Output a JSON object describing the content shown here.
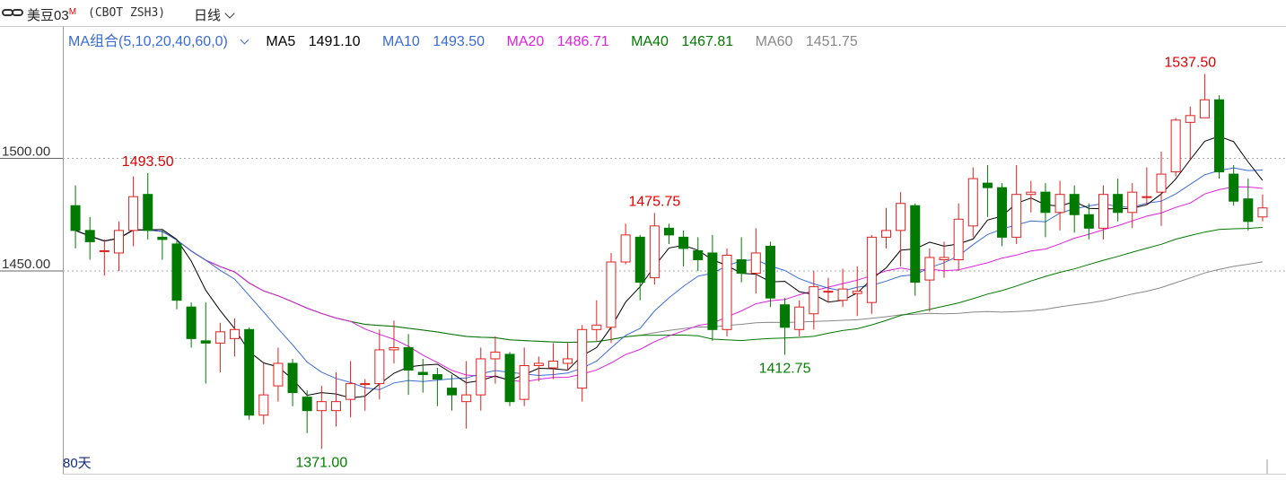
{
  "header": {
    "title": "美豆03",
    "title_sup": "M",
    "code": "(CBOT ZSH3)",
    "period": "日线"
  },
  "legend": {
    "combo": "MA组合(5,10,20,40,60,0)",
    "ma5_label": "MA5",
    "ma5_value": "1491.10",
    "ma10_label": "MA10",
    "ma10_value": "1493.50",
    "ma20_label": "MA20",
    "ma20_value": "1486.71",
    "ma40_label": "MA40",
    "ma40_value": "1467.81",
    "ma60_label": "MA60",
    "ma60_value": "1451.75"
  },
  "footer": {
    "days": "80天"
  },
  "colors": {
    "up": "#e02020",
    "down": "#007a00",
    "ma5": "#000000",
    "ma10": "#3a6bd6",
    "ma20": "#e020e0",
    "ma40": "#007a00",
    "ma60": "#888888",
    "peak": "#e00000",
    "trough": "#008000"
  },
  "chart_data": {
    "type": "candlestick",
    "ylim": [
      1360,
      1548
    ],
    "y_ticks": [
      {
        "value": 1500,
        "label": "1500.00"
      },
      {
        "value": 1450,
        "label": "1450.00"
      }
    ],
    "annotations": [
      {
        "label": "1493.50",
        "index": 5,
        "value": 1493.5,
        "kind": "high"
      },
      {
        "label": "1371.00",
        "index": 17,
        "value": 1371.0,
        "kind": "low"
      },
      {
        "label": "1475.75",
        "index": 40,
        "value": 1475.75,
        "kind": "high"
      },
      {
        "label": "1412.75",
        "index": 49,
        "value": 1412.75,
        "kind": "low"
      },
      {
        "label": "1537.50",
        "index": 77,
        "value": 1537.5,
        "kind": "high"
      }
    ],
    "candles": [
      [
        1479,
        1468,
        1488,
        1460
      ],
      [
        1468,
        1463,
        1474,
        1455
      ],
      [
        1459,
        1459,
        1464,
        1448
      ],
      [
        1458,
        1468,
        1472,
        1450
      ],
      [
        1468,
        1483,
        1492,
        1461
      ],
      [
        1484,
        1468,
        1493.5,
        1464
      ],
      [
        1465,
        1464,
        1468,
        1455
      ],
      [
        1462,
        1437,
        1464,
        1433
      ],
      [
        1434,
        1420,
        1436,
        1416
      ],
      [
        1419,
        1418,
        1436,
        1400
      ],
      [
        1418,
        1423,
        1427,
        1405
      ],
      [
        1420,
        1424,
        1429,
        1412
      ],
      [
        1424,
        1386,
        1425,
        1384
      ],
      [
        1386,
        1395,
        1409,
        1382
      ],
      [
        1399,
        1409,
        1416,
        1392
      ],
      [
        1409,
        1396,
        1411,
        1390
      ],
      [
        1394,
        1388,
        1397,
        1378
      ],
      [
        1388,
        1392,
        1399,
        1371
      ],
      [
        1388,
        1392,
        1405,
        1381
      ],
      [
        1393,
        1400,
        1410,
        1385
      ],
      [
        1400,
        1400,
        1402,
        1388
      ],
      [
        1400,
        1415,
        1424,
        1393
      ],
      [
        1415,
        1416,
        1428,
        1409
      ],
      [
        1416,
        1406,
        1422,
        1395
      ],
      [
        1405,
        1404,
        1411,
        1396
      ],
      [
        1404,
        1402,
        1407,
        1390
      ],
      [
        1398,
        1395,
        1404,
        1388
      ],
      [
        1392,
        1395,
        1410,
        1380
      ],
      [
        1395,
        1411,
        1416,
        1388
      ],
      [
        1411,
        1414,
        1421,
        1400
      ],
      [
        1413,
        1392,
        1414,
        1390
      ],
      [
        1393,
        1408,
        1416,
        1390
      ],
      [
        1408,
        1409,
        1412,
        1401
      ],
      [
        1407,
        1410,
        1418,
        1402
      ],
      [
        1409,
        1411,
        1418,
        1406
      ],
      [
        1398,
        1424,
        1426,
        1392
      ],
      [
        1424,
        1426,
        1437,
        1419
      ],
      [
        1425,
        1454,
        1458,
        1418
      ],
      [
        1454,
        1466,
        1471,
        1453
      ],
      [
        1465,
        1445,
        1466,
        1437
      ],
      [
        1447,
        1470,
        1475.75,
        1444
      ],
      [
        1469,
        1466,
        1471,
        1462
      ],
      [
        1465,
        1460,
        1468,
        1452
      ],
      [
        1459,
        1455,
        1465,
        1450
      ],
      [
        1458,
        1424,
        1466,
        1419
      ],
      [
        1424,
        1457,
        1460,
        1421
      ],
      [
        1455,
        1449,
        1465,
        1445
      ],
      [
        1449,
        1458,
        1469,
        1440
      ],
      [
        1461,
        1438,
        1463,
        1434
      ],
      [
        1435,
        1425,
        1438,
        1412.75
      ],
      [
        1424,
        1434,
        1437,
        1421
      ],
      [
        1431,
        1443,
        1450,
        1424
      ],
      [
        1441,
        1441,
        1447,
        1436
      ],
      [
        1437,
        1442,
        1451,
        1434
      ],
      [
        1440,
        1441,
        1452,
        1430
      ],
      [
        1436,
        1465,
        1466,
        1431
      ],
      [
        1465,
        1468,
        1478,
        1460
      ],
      [
        1468,
        1480,
        1485,
        1452
      ],
      [
        1479,
        1445,
        1480,
        1439
      ],
      [
        1446,
        1456,
        1460,
        1432
      ],
      [
        1455,
        1456,
        1463,
        1447
      ],
      [
        1455,
        1473,
        1480,
        1450
      ],
      [
        1470,
        1491,
        1496,
        1465
      ],
      [
        1489,
        1487,
        1497,
        1474
      ],
      [
        1487,
        1465,
        1489,
        1461
      ],
      [
        1465,
        1484,
        1497,
        1462
      ],
      [
        1484,
        1485,
        1490,
        1476
      ],
      [
        1485,
        1476,
        1489,
        1465
      ],
      [
        1476,
        1484,
        1490,
        1468
      ],
      [
        1484,
        1475,
        1488,
        1467
      ],
      [
        1475,
        1469,
        1480,
        1464
      ],
      [
        1469,
        1484,
        1488,
        1464
      ],
      [
        1484,
        1476,
        1491,
        1472
      ],
      [
        1476,
        1485,
        1489,
        1469
      ],
      [
        1483,
        1483,
        1496,
        1479
      ],
      [
        1485,
        1493,
        1503,
        1470
      ],
      [
        1494,
        1517,
        1518,
        1492
      ],
      [
        1516,
        1519,
        1523,
        1499
      ],
      [
        1518,
        1526,
        1537.5,
        1518
      ],
      [
        1526,
        1494,
        1528,
        1491
      ],
      [
        1493,
        1481,
        1497,
        1479
      ],
      [
        1482,
        1472,
        1491,
        1468
      ],
      [
        1474,
        1478,
        1484,
        1472
      ]
    ]
  }
}
